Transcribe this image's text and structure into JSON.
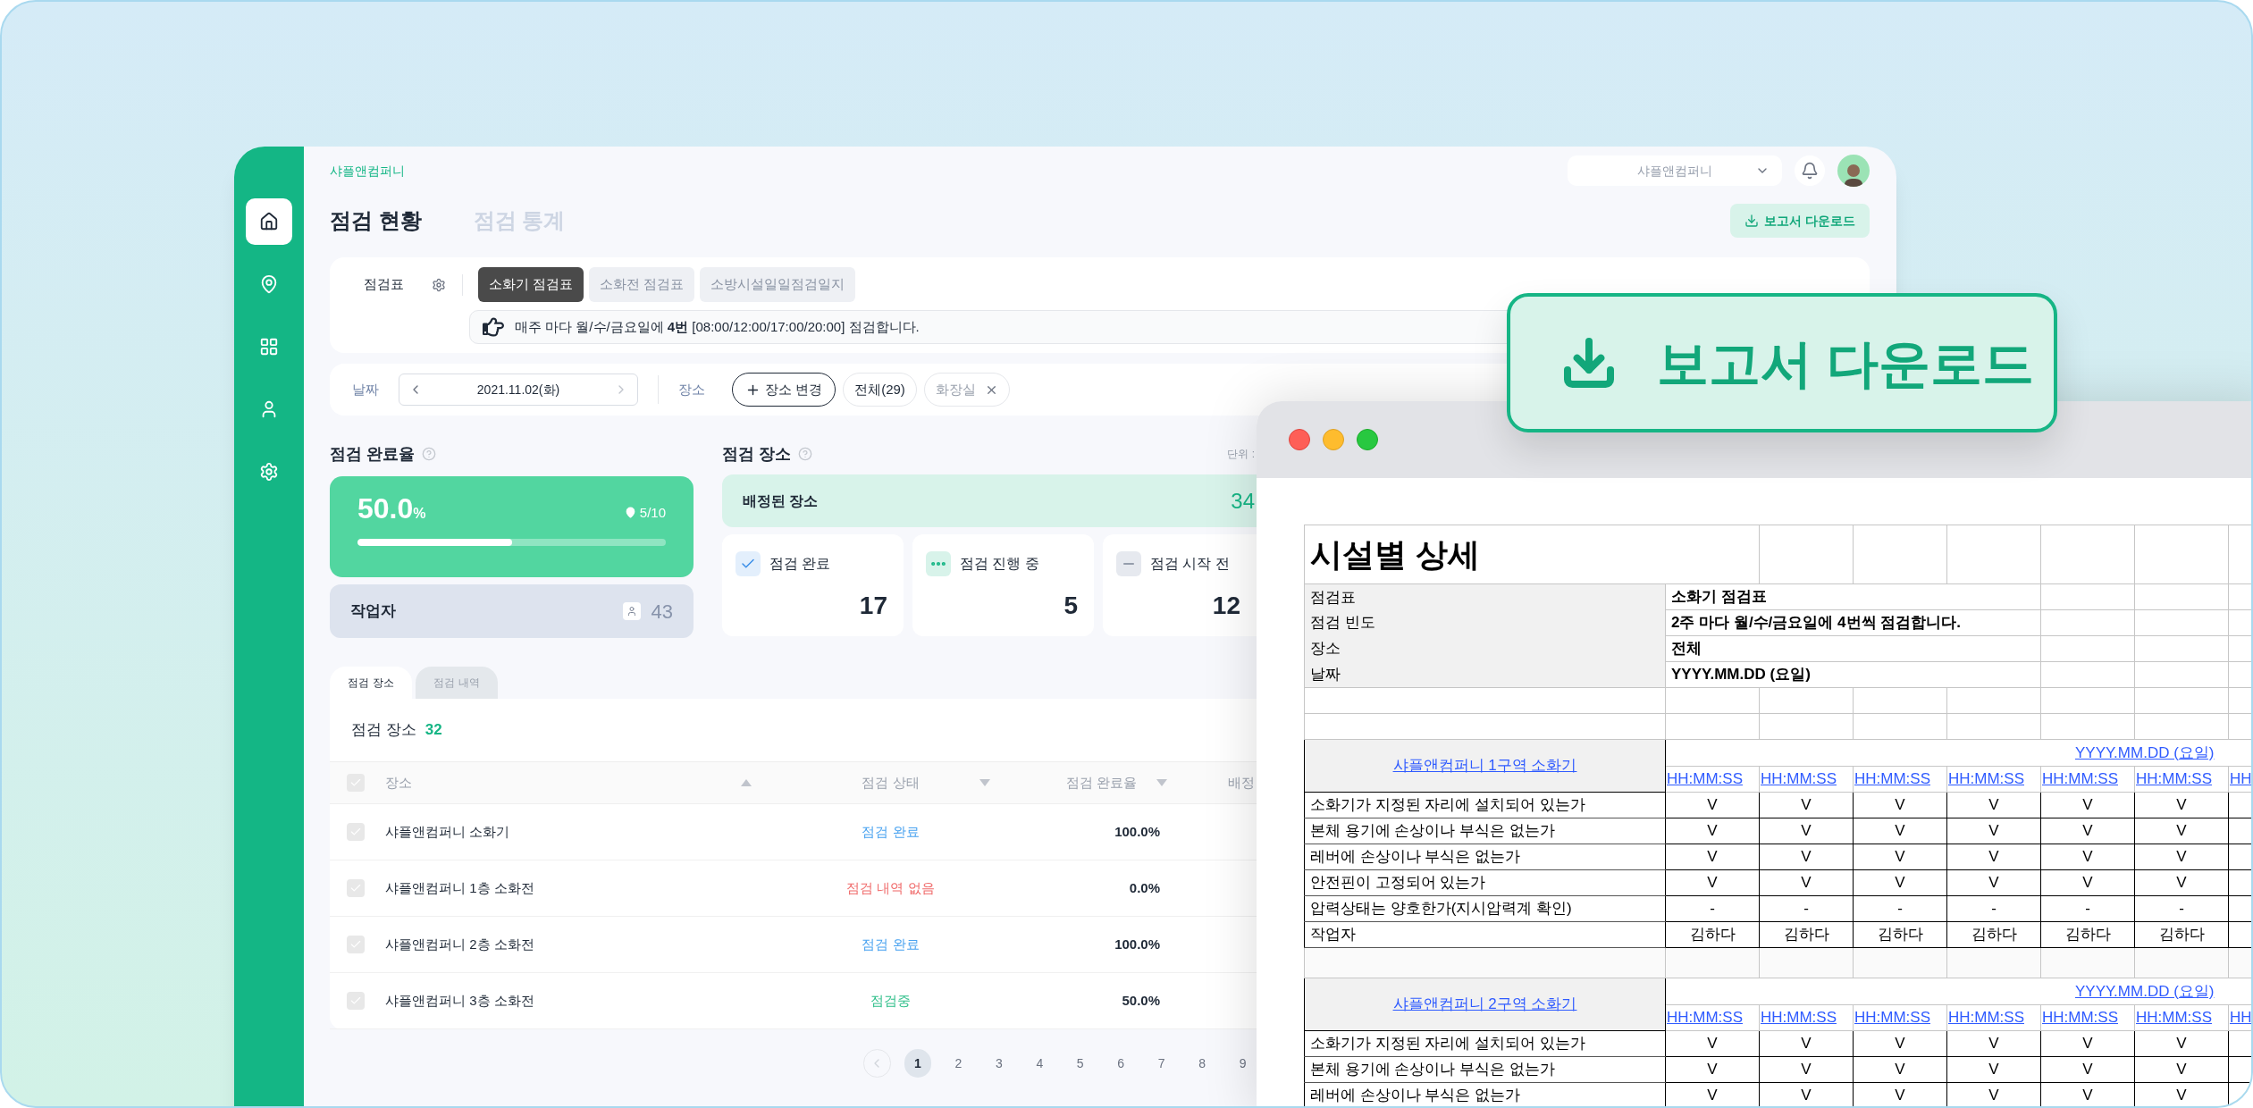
{
  "sidebar": {
    "items": [
      {
        "selected": true
      },
      {
        "selected": false
      },
      {
        "selected": false
      },
      {
        "selected": false
      },
      {
        "selected": false
      }
    ]
  },
  "header": {
    "company": "샤플앤컴퍼니",
    "company_select": "샤플앤컴퍼니"
  },
  "page_tabs": [
    {
      "label": "점검 현황",
      "selected": true
    },
    {
      "label": "점검 통계",
      "selected": false
    }
  ],
  "download_button": "보고서 다운로드",
  "checklist": {
    "label": "점검표",
    "tabs": [
      {
        "label": "소화기 점검표",
        "selected": true
      },
      {
        "label": "소화전 점검표",
        "selected": false
      },
      {
        "label": "소방시설일일점검일지",
        "selected": false
      }
    ],
    "notice": "매주 마다 월/수/금요일에 **4번** [08:00/12:00/17:00/20:00] 점검합니다."
  },
  "filters": {
    "date_label": "날짜",
    "date": "2021.11.02(화)",
    "place_label": "장소",
    "change_button": "장소 변경",
    "chips": [
      {
        "label": "전체(29)",
        "removable": false
      },
      {
        "label": "화장실",
        "removable": true
      }
    ]
  },
  "completion": {
    "title": "점검 완료율",
    "rate": "50.0",
    "unit": "%",
    "count": "5/10",
    "level": 0.5,
    "workers_label": "작업자",
    "workers": "43"
  },
  "places": {
    "title": "점검 장소",
    "unit_note": "단위 :",
    "assigned_label": "배정된 장소",
    "assigned": "34",
    "cards": [
      {
        "kind": "done",
        "label": "점검 완료",
        "value": "17"
      },
      {
        "kind": "progress",
        "label": "점검 진행 중",
        "value": "5"
      },
      {
        "kind": "pending",
        "label": "점검 시작 전",
        "value": "12"
      }
    ]
  },
  "table": {
    "tabs": [
      {
        "label": "점검 장소",
        "selected": true
      },
      {
        "label": "점검 내역",
        "selected": false
      }
    ],
    "title": "점검 장소",
    "count": "32",
    "header_checked": false,
    "columns": [
      {
        "label": "장소",
        "kind": "asc"
      },
      {
        "label": "점검 상태",
        "kind": "desc"
      },
      {
        "label": "점검 완료율",
        "kind": "desc"
      },
      {
        "label": "배정",
        "kind": "plain"
      }
    ],
    "rows": [
      {
        "checked": false,
        "name": "샤플앤컴퍼니 소화기",
        "status": "점검 완료",
        "kind": "done",
        "rate": "100.0%"
      },
      {
        "checked": false,
        "name": "샤플앤컴퍼니 1층 소화전",
        "status": "점검 내역 없음",
        "kind": "none",
        "rate": "0.0%"
      },
      {
        "checked": false,
        "name": "샤플앤컴퍼니 2층 소화전",
        "status": "점검 완료",
        "kind": "done",
        "rate": "100.0%"
      },
      {
        "checked": false,
        "name": "샤플앤컴퍼니 3층 소화전",
        "status": "점검중",
        "kind": "progress",
        "rate": "50.0%"
      }
    ]
  },
  "pagination": {
    "pages": [
      {
        "label": "1",
        "selected": true
      },
      {
        "label": "2",
        "selected": false
      },
      {
        "label": "3",
        "selected": false
      },
      {
        "label": "4",
        "selected": false
      },
      {
        "label": "5",
        "selected": false
      },
      {
        "label": "6",
        "selected": false
      },
      {
        "label": "7",
        "selected": false
      },
      {
        "label": "8",
        "selected": false
      },
      {
        "label": "9",
        "selected": false
      }
    ]
  },
  "download_callout": "보고서 다운로드",
  "report": {
    "title": "시설별 상세",
    "info": [
      {
        "label": "점검표",
        "value": "소화기 점검표"
      },
      {
        "label": "점검 빈도",
        "value": "2주 마다 월/수/금요일에 4번씩 점검합니다."
      },
      {
        "label": "장소",
        "value": "전체"
      },
      {
        "label": "날짜",
        "value": "YYYY.MM.DD (요일)"
      }
    ],
    "sections": [
      {
        "name": "샤플앤컴퍼니 1구역 소화기",
        "date": "YYYY.MM.DD (요일)",
        "times": [
          "HH:MM:SS",
          "HH:MM:SS",
          "HH:MM:SS",
          "HH:MM:SS",
          "HH:MM:SS",
          "HH:MM:SS",
          "HH"
        ],
        "rows": [
          {
            "label": "소화기가 지정된 자리에 설치되어 있는가",
            "cells": [
              "V",
              "V",
              "V",
              "V",
              "V",
              "V"
            ]
          },
          {
            "label": "본체 용기에 손상이나 부식은 없는가",
            "cells": [
              "V",
              "V",
              "V",
              "V",
              "V",
              "V"
            ]
          },
          {
            "label": "레버에 손상이나 부식은 없는가",
            "cells": [
              "V",
              "V",
              "V",
              "V",
              "V",
              "V"
            ]
          },
          {
            "label": "안전핀이 고정되어 있는가",
            "cells": [
              "V",
              "V",
              "V",
              "V",
              "V",
              "V"
            ]
          },
          {
            "label": "압력상태는 양호한가(지시압력계 확인)",
            "cells": [
              "-",
              "-",
              "-",
              "-",
              "-",
              "-"
            ]
          },
          {
            "label": "작업자",
            "cells": [
              "김하다",
              "김하다",
              "김하다",
              "김하다",
              "김하다",
              "김하다"
            ]
          }
        ]
      },
      {
        "name": "샤플앤컴퍼니 2구역 소화기",
        "date": "YYYY.MM.DD (요일)",
        "times": [
          "HH:MM:SS",
          "HH:MM:SS",
          "HH:MM:SS",
          "HH:MM:SS",
          "HH:MM:SS",
          "HH:MM:SS",
          "HH"
        ],
        "rows": [
          {
            "label": "소화기가 지정된 자리에 설치되어 있는가",
            "cells": [
              "V",
              "V",
              "V",
              "V",
              "V",
              "V"
            ]
          },
          {
            "label": "본체 용기에 손상이나 부식은 없는가",
            "cells": [
              "V",
              "V",
              "V",
              "V",
              "V",
              "V"
            ]
          },
          {
            "label": "레버에 손상이나 부식은 없는가",
            "cells": [
              "V",
              "V",
              "V",
              "V",
              "V",
              "V"
            ]
          }
        ]
      }
    ]
  }
}
